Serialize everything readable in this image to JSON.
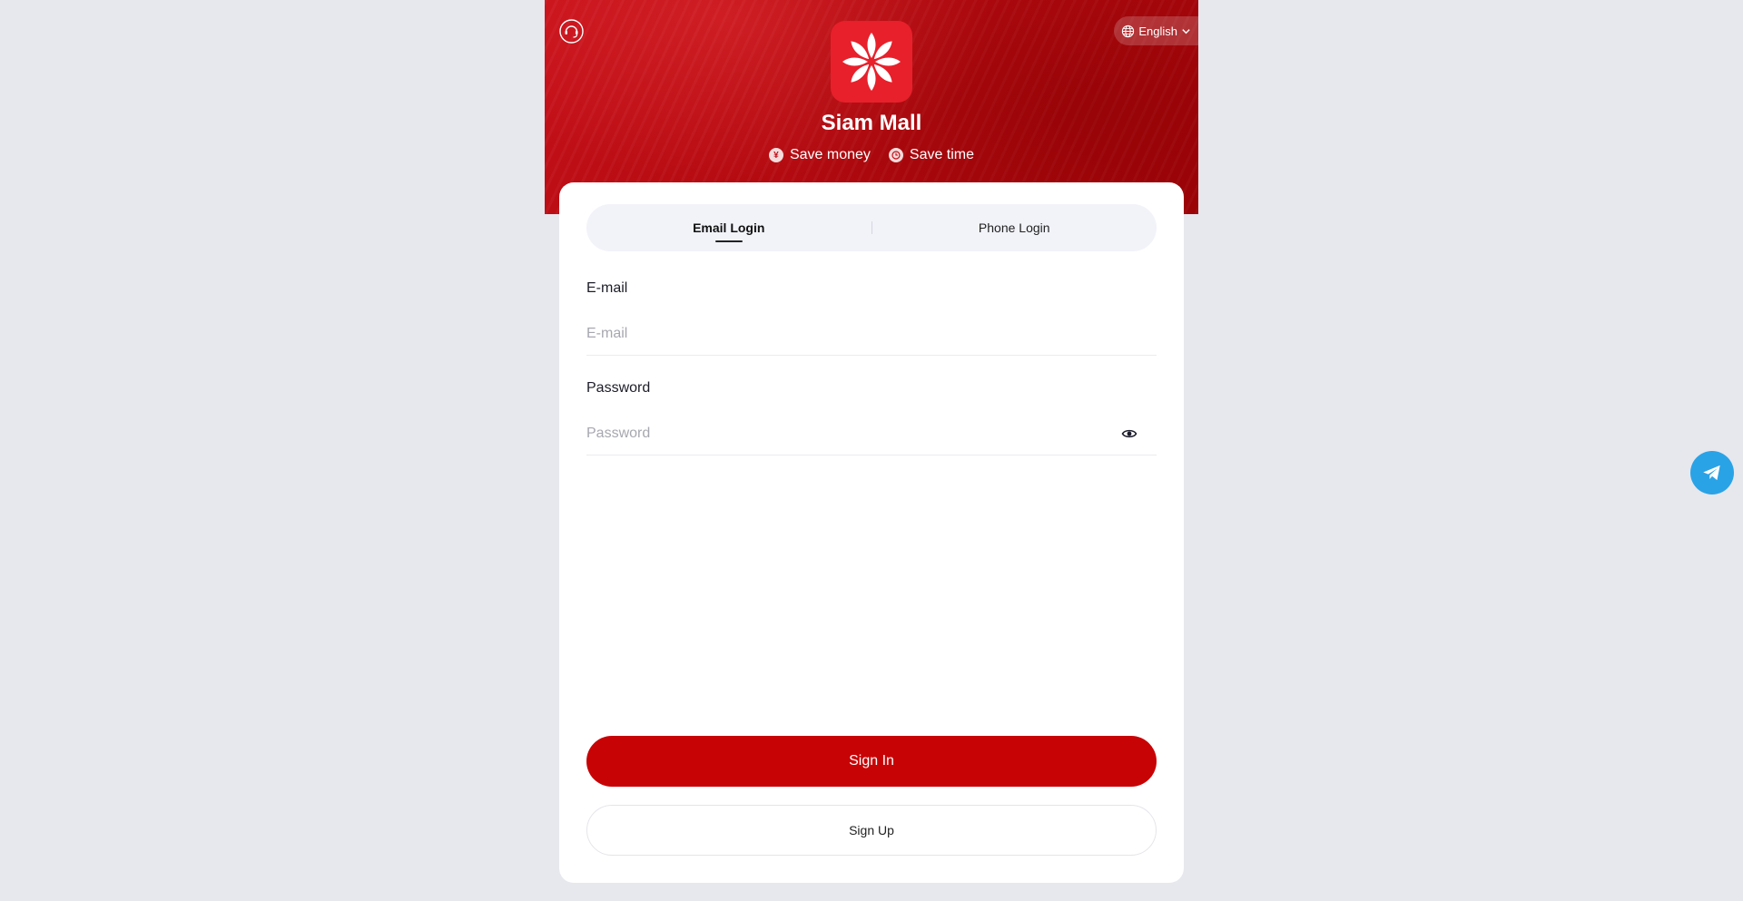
{
  "header": {
    "brand_name": "Siam Mall",
    "language_label": "English",
    "support_icon": "customer-service-icon",
    "language_icon": "globe-icon",
    "taglines": [
      {
        "icon": "money-icon",
        "text": "Save money"
      },
      {
        "icon": "clock-icon",
        "text": "Save time"
      }
    ],
    "colors": {
      "primary": "#c80306",
      "logo_bg": "#e8202b"
    }
  },
  "login": {
    "tabs": [
      {
        "label": "Email Login",
        "active": true
      },
      {
        "label": "Phone Login",
        "active": false
      }
    ],
    "email": {
      "label": "E-mail",
      "placeholder": "E-mail",
      "value": ""
    },
    "password": {
      "label": "Password",
      "placeholder": "Password",
      "value": ""
    },
    "signin_label": "Sign In",
    "signup_label": "Sign Up"
  },
  "floating": {
    "telegram_icon": "telegram-icon",
    "telegram_color": "#2aa3e6"
  }
}
